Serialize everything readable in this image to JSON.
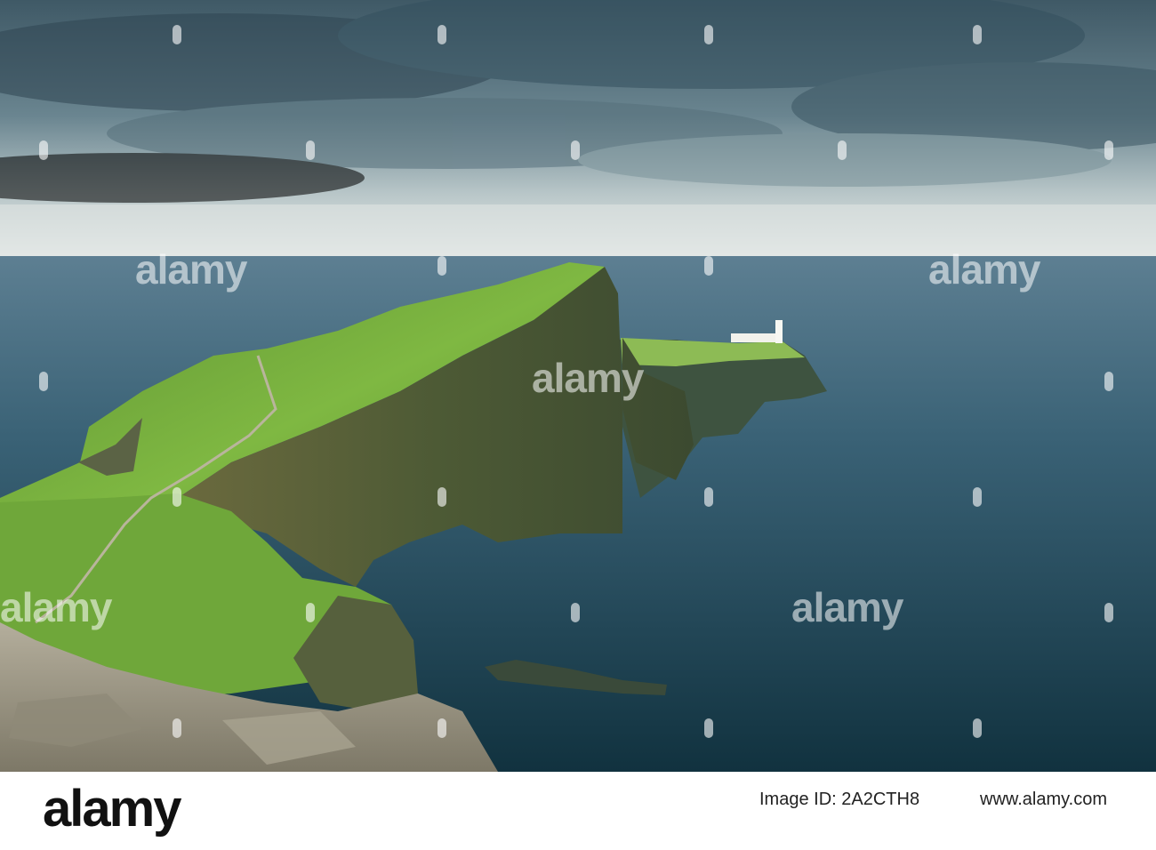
{
  "image": {
    "description_colors": {
      "sky_top": "#46606c",
      "sky_horizon": "#e6ebea",
      "sea": "#1f4456",
      "grass": "#6fa63a",
      "cliff": "#4b5a3a",
      "rock": "#9e9a8a"
    }
  },
  "watermarks": [
    "alamy",
    "alamy",
    "alamy",
    "alamy",
    "alamy"
  ],
  "footer": {
    "logo": "alamy",
    "image_id_prefix": "Image ID: ",
    "image_id": "2A2CTH8",
    "url": "www.alamy.com"
  }
}
